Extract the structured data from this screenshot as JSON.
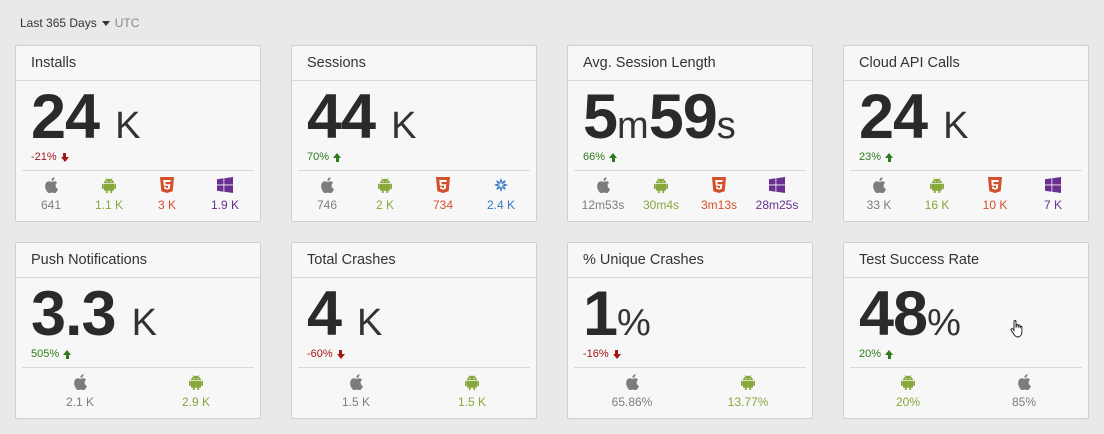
{
  "toolbar": {
    "range": "Last 365 Days",
    "timezone": "UTC"
  },
  "colors": {
    "apple": "#7d7d7d",
    "android": "#86a83c",
    "html5": "#d4502a",
    "windows": "#6a2f91",
    "tizen": "#3a79c4",
    "up": "#2f7a1a",
    "down": "#a01818"
  },
  "cards": [
    {
      "title": "Installs",
      "value": "24",
      "unit": "K",
      "change": "-21%",
      "trend": "down",
      "platforms": [
        {
          "icon": "apple-icon",
          "value": "641"
        },
        {
          "icon": "android-icon",
          "value": "1.1 K"
        },
        {
          "icon": "html5-icon",
          "value": "3 K"
        },
        {
          "icon": "windows-icon",
          "value": "1.9 K"
        }
      ]
    },
    {
      "title": "Sessions",
      "value": "44",
      "unit": "K",
      "change": "70%",
      "trend": "up",
      "platforms": [
        {
          "icon": "apple-icon",
          "value": "746"
        },
        {
          "icon": "android-icon",
          "value": "2 K"
        },
        {
          "icon": "html5-icon",
          "value": "734"
        },
        {
          "icon": "tizen-icon",
          "value": "2.4 K"
        }
      ]
    },
    {
      "title": "Avg. Session Length",
      "value_parts": [
        "5",
        "m",
        "59",
        "s"
      ],
      "change": "66%",
      "trend": "up",
      "platforms": [
        {
          "icon": "apple-icon",
          "value": "12m53s"
        },
        {
          "icon": "android-icon",
          "value": "30m4s"
        },
        {
          "icon": "html5-icon",
          "value": "3m13s"
        },
        {
          "icon": "windows-icon",
          "value": "28m25s"
        }
      ]
    },
    {
      "title": "Cloud API Calls",
      "value": "24",
      "unit": "K",
      "change": "23%",
      "trend": "up",
      "platforms": [
        {
          "icon": "apple-icon",
          "value": "33 K"
        },
        {
          "icon": "android-icon",
          "value": "16 K"
        },
        {
          "icon": "html5-icon",
          "value": "10 K"
        },
        {
          "icon": "windows-icon",
          "value": "7 K"
        }
      ]
    },
    {
      "title": "Push Notifications",
      "value": "3.3",
      "unit": "K",
      "change": "505%",
      "trend": "up",
      "platforms": [
        {
          "icon": "apple-icon",
          "value": "2.1 K"
        },
        {
          "icon": "android-icon",
          "value": "2.9 K"
        }
      ]
    },
    {
      "title": "Total Crashes",
      "value": "4",
      "unit": "K",
      "change": "-60%",
      "trend": "down",
      "platforms": [
        {
          "icon": "apple-icon",
          "value": "1.5 K"
        },
        {
          "icon": "android-icon",
          "value": "1.5 K"
        }
      ]
    },
    {
      "title": "% Unique Crashes",
      "value": "1",
      "unit": "%",
      "change": "-16%",
      "trend": "down",
      "platforms": [
        {
          "icon": "apple-icon",
          "value": "65.86%"
        },
        {
          "icon": "android-icon",
          "value": "13.77%"
        }
      ]
    },
    {
      "title": "Test Success Rate",
      "value": "48",
      "unit": "%",
      "change": "20%",
      "trend": "up",
      "platforms": [
        {
          "icon": "android-icon",
          "value": "20%"
        },
        {
          "icon": "apple-icon",
          "value": "85%"
        }
      ]
    }
  ]
}
